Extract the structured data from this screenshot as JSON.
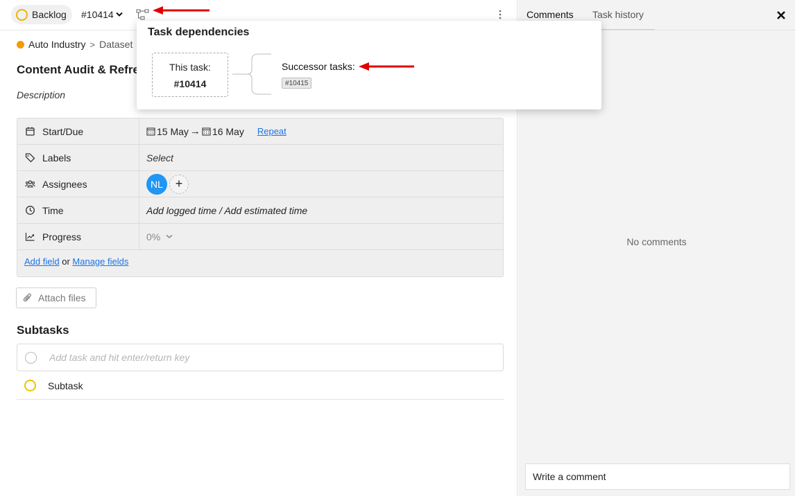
{
  "topbar": {
    "status_label": "Backlog",
    "task_id": "#10414",
    "status_color": "#f0b400"
  },
  "breadcrumb": {
    "project": "Auto Industry",
    "section": "Dataset",
    "project_color": "#f59b00"
  },
  "task": {
    "title": "Content Audit & Refre",
    "description_label": "Description"
  },
  "fields": {
    "start_due": {
      "label": "Start/Due",
      "start": "15 May",
      "arrow": "→",
      "due": "16 May",
      "repeat": "Repeat"
    },
    "labels": {
      "label": "Labels",
      "value": "Select"
    },
    "assignees": {
      "label": "Assignees",
      "avatar": "NL",
      "add": "+",
      "avatar_color": "#2196f3"
    },
    "time": {
      "label": "Time",
      "value": "Add logged time / Add estimated time"
    },
    "progress": {
      "label": "Progress",
      "value": "0%"
    },
    "add_field": "Add field",
    "or": "or",
    "manage_fields": "Manage fields"
  },
  "attach_label": "Attach files",
  "subtasks": {
    "heading": "Subtasks",
    "placeholder": "Add task and hit enter/return key",
    "items": [
      "Subtask"
    ]
  },
  "right": {
    "tabs": [
      "Comments",
      "Task history"
    ],
    "empty": "No comments",
    "comment_placeholder": "Write a comment"
  },
  "popover": {
    "title": "Task dependencies",
    "this_label": "This task:",
    "this_id": "#10414",
    "successor_label": "Successor tasks:",
    "successor_ids": [
      "#10415"
    ]
  },
  "annotation_color": "#e00000"
}
